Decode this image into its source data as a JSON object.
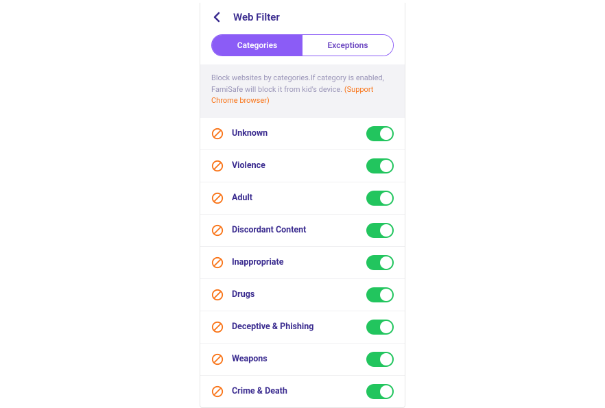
{
  "header": {
    "title": "Web Filter"
  },
  "tabs": {
    "categories": "Categories",
    "exceptions": "Exceptions"
  },
  "info": {
    "text": "Block websites by categories.If category is enabled, FamiSafe will block it from kid's device. ",
    "highlight": "(Support Chrome browser)"
  },
  "categories": [
    {
      "label": "Unknown",
      "enabled": true
    },
    {
      "label": "Violence",
      "enabled": true
    },
    {
      "label": "Adult",
      "enabled": true
    },
    {
      "label": "Discordant Content",
      "enabled": true
    },
    {
      "label": "Inappropriate",
      "enabled": true
    },
    {
      "label": "Drugs",
      "enabled": true
    },
    {
      "label": "Deceptive & Phishing",
      "enabled": true
    },
    {
      "label": "Weapons",
      "enabled": true
    },
    {
      "label": "Crime & Death",
      "enabled": true
    }
  ]
}
